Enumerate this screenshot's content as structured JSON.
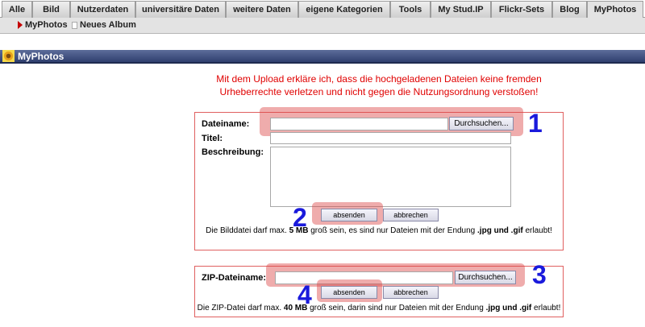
{
  "tabs": [
    {
      "label": "Alle"
    },
    {
      "label": "Bild"
    },
    {
      "label": "Nutzerdaten"
    },
    {
      "label": "universitäre Daten"
    },
    {
      "label": "weitere Daten"
    },
    {
      "label": "eigene Kategorien"
    },
    {
      "label": "Tools"
    },
    {
      "label": "My Stud.IP"
    },
    {
      "label": "Flickr-Sets"
    },
    {
      "label": "Blog"
    },
    {
      "label": "MyPhotos"
    }
  ],
  "subnav": {
    "myphotos": "MyPhotos",
    "new_album": "Neues Album"
  },
  "header": {
    "title": "MyPhotos"
  },
  "notice": {
    "line1": "Mit dem Upload erkläre ich, dass die hochgeladenen Dateien keine fremden",
    "line2": "Urheberrechte verletzen und nicht gegen die Nutzungsordnung verstoßen!"
  },
  "image_form": {
    "filename_label": "Dateiname:",
    "title_label": "Titel:",
    "description_label": "Beschreibung:",
    "browse_label": "Durchsuchen...",
    "submit_label": "absenden",
    "cancel_label": "abbrechen",
    "info_prefix": "Die Bilddatei darf max. ",
    "info_size": "5 MB",
    "info_middle": " groß sein, es sind nur Dateien mit der Endung ",
    "info_ext": ".jpg und .gif",
    "info_suffix": " erlaubt!"
  },
  "zip_form": {
    "filename_label": "ZIP-Dateiname:",
    "browse_label": "Durchsuchen...",
    "submit_label": "absenden",
    "cancel_label": "abbrechen",
    "info_prefix": "Die ZIP-Datei darf max. ",
    "info_size": "40 MB",
    "info_middle": " groß sein, darin sind nur Dateien mit der Endung ",
    "info_ext": ".jpg und .gif",
    "info_suffix": " erlaubt!"
  },
  "callouts": [
    "1",
    "2",
    "3",
    "4"
  ],
  "colors": {
    "notice": "#e00000",
    "highlight": "#dc4646",
    "callout": "#1a1adc",
    "header": "#2f3f6f"
  }
}
